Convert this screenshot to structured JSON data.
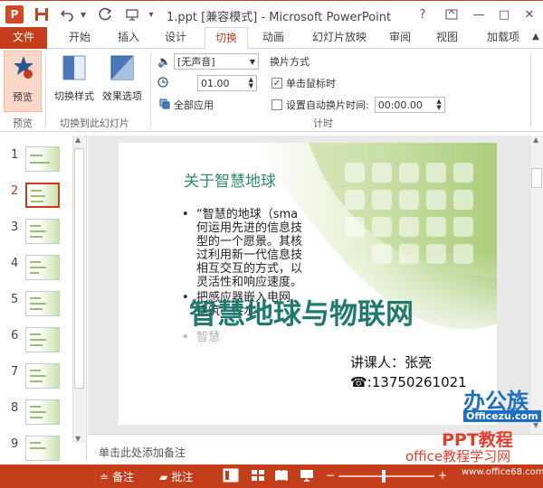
{
  "window": {
    "title": "1.ppt [兼容模式] - Microsoft PowerPoint",
    "app_icon": "P",
    "controls": [
      "?",
      "—",
      "□",
      "✕"
    ]
  },
  "tabs": [
    "文件",
    "开始",
    "插入",
    "设计",
    "切换",
    "动画",
    "幻灯片放映",
    "审阅",
    "视图",
    "加载项"
  ],
  "active_tab": "切换",
  "ribbon": {
    "preview": {
      "button": "预览",
      "group": "预览"
    },
    "transitions": {
      "style_button": "切换样式",
      "effect_button": "效果选项",
      "group": "切换到此幻灯片"
    },
    "timing": {
      "sound": "[无声音]",
      "duration": "01.00",
      "apply_all": "全部应用",
      "advance_title": "换片方式",
      "on_click": "单击鼠标时",
      "on_click_checked": true,
      "after_time": "设置自动换片时间:",
      "after_time_checked": false,
      "after_value": "00:00.00",
      "group": "计时"
    }
  },
  "thumbnails": [
    "1",
    "2",
    "3",
    "4",
    "5",
    "6",
    "7",
    "8",
    "9"
  ],
  "selected_thumbnail": "2",
  "slide": {
    "title": "关于智慧地球",
    "bullet_1_lines": [
      "“智慧的地球（sma",
      "何运用先进的信息技",
      "型的一个愿景。其核",
      "过利用新一代信息技",
      "相互交互的方式，以",
      "灵活性和响应速度。"
    ],
    "bullet_2_lines": [
      "把感应器嵌入电网",
      "建筑、供水"
    ],
    "bullet_3_fragment": "智慧",
    "overlay_title": "智慧地球与物联网",
    "lecturer": "讲课人：张亮",
    "phone": "☎:13750261021"
  },
  "notes_placeholder": "单击此处添加备注",
  "status": {
    "notes": "备注",
    "comments": "批注"
  },
  "watermarks": {
    "logo_main": "办公族",
    "logo_site": "Officezu.com",
    "brand": "PPT教程",
    "learn": "office教程学习网",
    "url": "www.office68.com"
  },
  "colors": {
    "accent": "#c43e1c",
    "slide_green": "#1e7a6a",
    "ribbon_bg": "#ffffff"
  }
}
